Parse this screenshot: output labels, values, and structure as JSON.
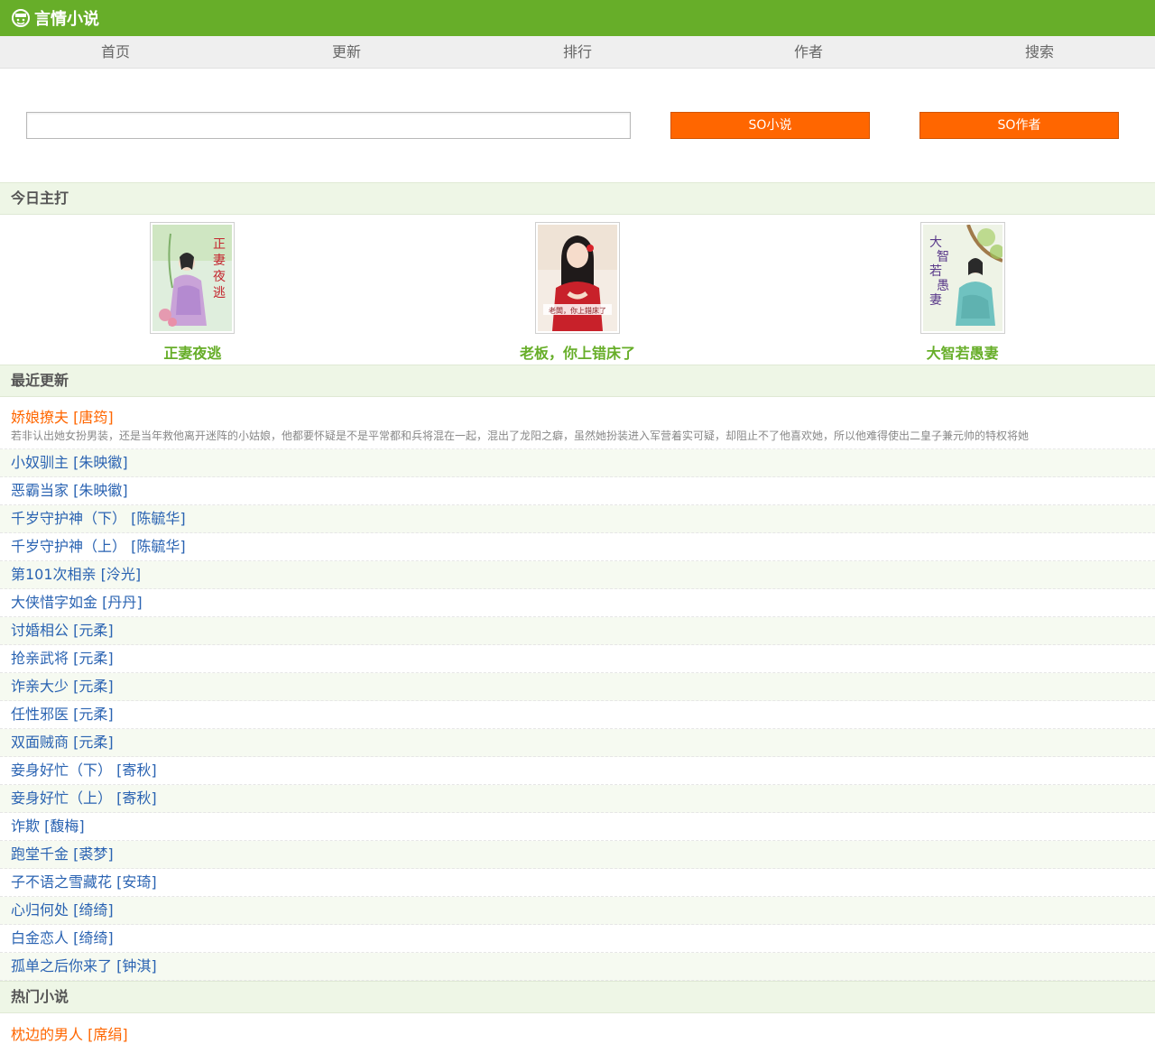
{
  "header": {
    "logo_icon": "book-face-icon",
    "logo_text": "言情小说",
    "brand_color": "#67ae29"
  },
  "nav": [
    "首页",
    "更新",
    "排行",
    "作者",
    "搜索"
  ],
  "search": {
    "placeholder": "",
    "value": "",
    "novel_button": "SO小说",
    "author_button": "SO作者",
    "button_color": "#ff6600"
  },
  "featured": {
    "heading": "今日主打",
    "books": [
      {
        "title": "正妻夜逃",
        "cover_text": "正妻夜逃"
      },
      {
        "title": "老板，你上错床了",
        "cover_text": "老板，你上錯床了"
      },
      {
        "title": "大智若愚妻",
        "cover_text": "大智若愚妻"
      }
    ]
  },
  "recent": {
    "heading": "最近更新",
    "first": {
      "title": "娇娘撩夫 [唐筠]",
      "desc": "若非认出她女扮男装，还是当年救他离开迷阵的小姑娘，他都要怀疑是不是平常都和兵将混在一起，混出了龙阳之癖，虽然她扮装进入军营着实可疑，却阻止不了他喜欢她，所以他难得使出二皇子兼元帅的特权将她"
    },
    "items": [
      "小奴驯主 [朱映徽]",
      "恶霸当家 [朱映徽]",
      "千岁守护神（下） [陈毓华]",
      "千岁守护神（上） [陈毓华]",
      "第101次相亲 [泠光]",
      "大侠惜字如金 [丹丹]",
      "讨婚相公 [元柔]",
      "抢亲武将 [元柔]",
      "诈亲大少 [元柔]",
      "任性邪医 [元柔]",
      "双面贼商 [元柔]",
      "妾身好忙（下） [寄秋]",
      "妾身好忙（上） [寄秋]",
      "诈欺 [馥梅]",
      "跑堂千金 [裘梦]",
      "子不语之雪藏花 [安琦]",
      "心归何处 [绮绮]",
      "白金恋人 [绮绮]",
      "孤单之后你来了 [钟淇]"
    ]
  },
  "hot": {
    "heading": "热门小说",
    "first": "枕边的男人 [席绢]"
  }
}
